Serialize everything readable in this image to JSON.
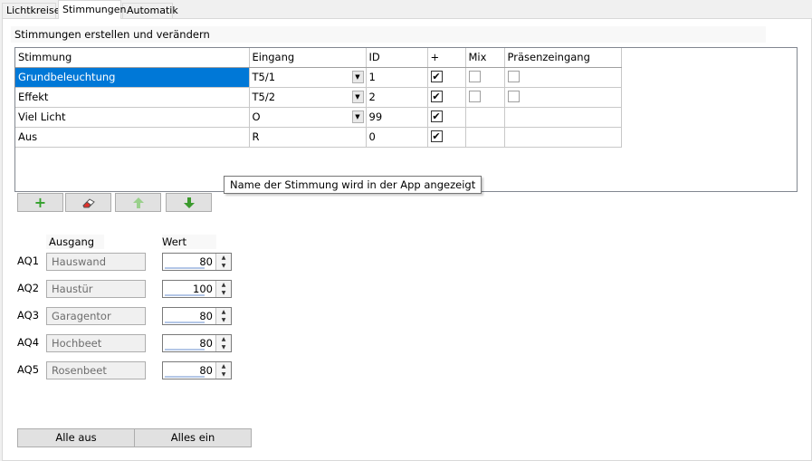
{
  "tabs": [
    {
      "label": "Lichtkreise"
    },
    {
      "label": "Stimmungen"
    },
    {
      "label": "Automatik"
    }
  ],
  "group_title": "Stimmungen erstellen und verändern",
  "grid": {
    "columns": [
      "Stimmung",
      "Eingang",
      "ID",
      "+",
      "Mix",
      "Präsenzeingang"
    ],
    "rows": [
      {
        "name": "Grundbeleuchtung",
        "input": "T5/1",
        "id": "1",
        "plus": true,
        "mix": false,
        "presence": false,
        "selected": true,
        "dropdown": true,
        "extra": true
      },
      {
        "name": "Effekt",
        "input": "T5/2",
        "id": "2",
        "plus": true,
        "mix": false,
        "presence": false,
        "selected": false,
        "dropdown": true,
        "extra": true
      },
      {
        "name": "Viel Licht",
        "input": "O",
        "id": "99",
        "plus": true,
        "selected": false,
        "dropdown": true,
        "extra": false
      },
      {
        "name": "Aus",
        "input": "R",
        "id": "0",
        "plus": true,
        "selected": false,
        "dropdown": false,
        "extra": false
      }
    ]
  },
  "tooltip": "Name der Stimmung wird in der App angezeigt",
  "toolbar": {
    "add_icon": "plus-icon",
    "delete_icon": "eraser-icon",
    "up_icon": "arrow-up-icon",
    "down_icon": "arrow-down-icon",
    "add_color": "#33a02c",
    "delete_color": "#e0302a",
    "up_color": "#9ad08c",
    "down_color": "#3c9a2e"
  },
  "outputs": {
    "col_output": "Ausgang",
    "col_value": "Wert",
    "items": [
      {
        "label": "AQ1",
        "name": "Hauswand",
        "value": "80"
      },
      {
        "label": "AQ2",
        "name": "Haustür",
        "value": "100"
      },
      {
        "label": "AQ3",
        "name": "Garagentor",
        "value": "80"
      },
      {
        "label": "AQ4",
        "name": "Hochbeet",
        "value": "80"
      },
      {
        "label": "AQ5",
        "name": "Rosenbeet",
        "value": "80"
      }
    ]
  },
  "buttons": {
    "all_off": "Alle aus",
    "all_on": "Alles ein"
  },
  "colors": {
    "selection": "#0078d7"
  }
}
